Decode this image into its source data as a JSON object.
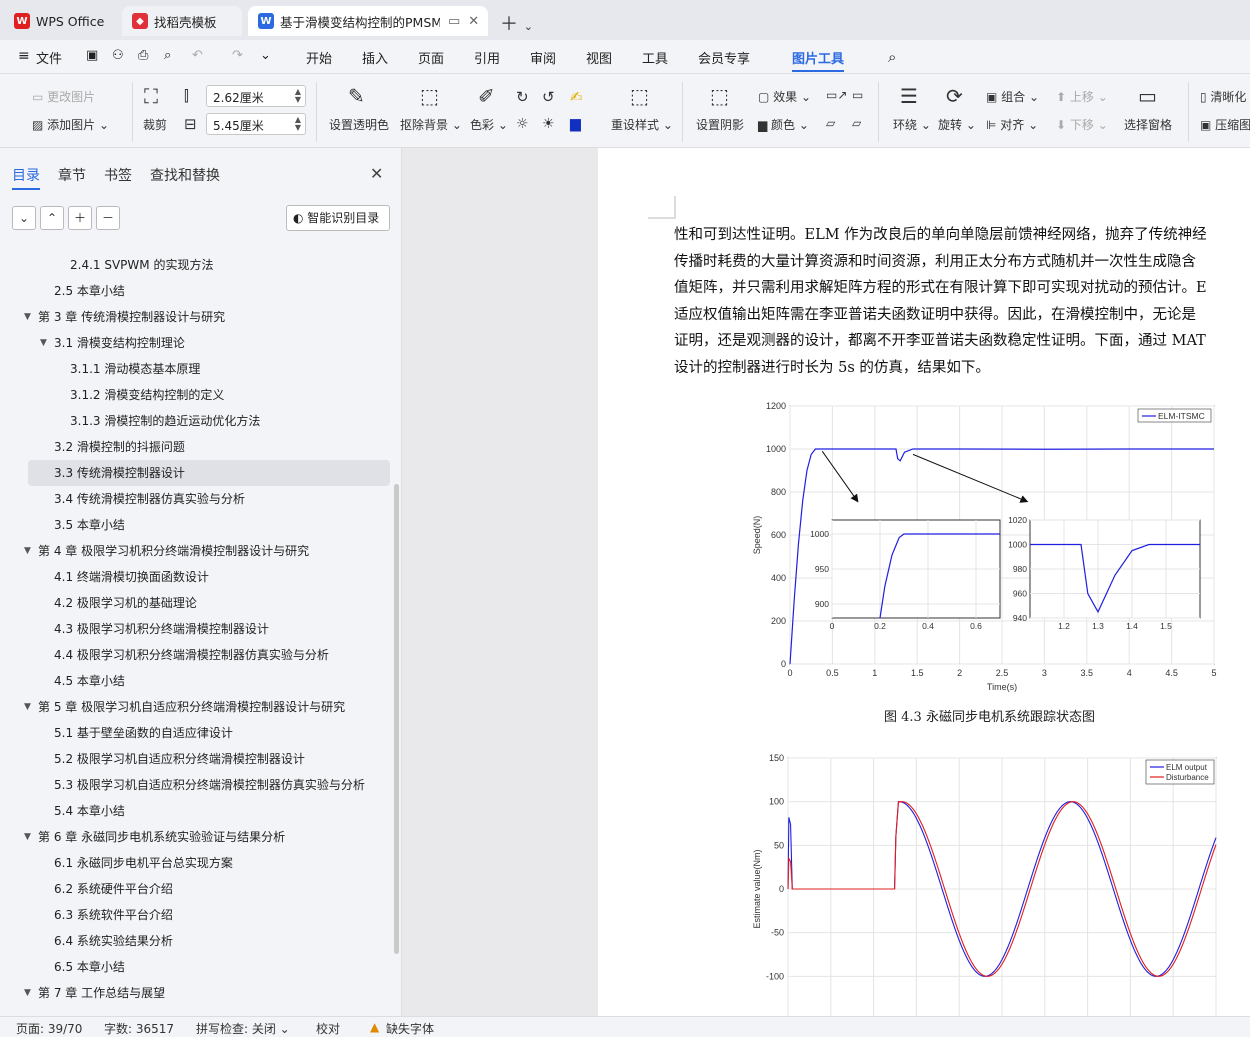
{
  "tabs": [
    {
      "label": "WPS Office",
      "icon": "wps-logo-icon"
    },
    {
      "label": "找稻壳模板",
      "icon": "docer-icon"
    },
    {
      "label": "基于滑模变结构控制的PMSM",
      "icon": "word-doc-icon"
    }
  ],
  "menu": {
    "file": "文件",
    "items": [
      "开始",
      "插入",
      "页面",
      "引用",
      "审阅",
      "视图",
      "工具",
      "会员专享"
    ],
    "active": "图片工具"
  },
  "ribbon": {
    "change_pic": "更改图片",
    "add_pic": "添加图片",
    "crop": "裁剪",
    "width": "2.62厘米",
    "height": "5.45厘米",
    "transparent": "设置透明色",
    "remove_bg": "抠除背景",
    "color": "色彩",
    "reset_style": "重设样式",
    "shadow": "设置阴影",
    "effect": "效果",
    "color2": "颜色",
    "wrap": "环绕",
    "rotate": "旋转",
    "group": "组合",
    "align": "对齐",
    "up": "上移",
    "down": "下移",
    "select_pane": "选择窗格",
    "clear": "清晰化",
    "compress": "压缩图"
  },
  "sidebar": {
    "tabs": [
      "目录",
      "章节",
      "书签",
      "查找和替换"
    ],
    "smart": "智能识别目录",
    "toc": [
      {
        "label": "2.4.1 SVPWM 的实现方法",
        "level": 3
      },
      {
        "label": "2.5  本章小结",
        "level": 2
      },
      {
        "label": "第 3 章  传统滑模控制器设计与研究",
        "level": 1
      },
      {
        "label": "3.1  滑模变结构控制理论",
        "level": 2
      },
      {
        "label": "3.1.1  滑动模态基本原理",
        "level": 3
      },
      {
        "label": "3.1.2  滑模变结构控制的定义",
        "level": 3
      },
      {
        "label": "3.1.3  滑模控制的趋近运动优化方法",
        "level": 3
      },
      {
        "label": "3.2  滑模控制的抖振问题",
        "level": 2
      },
      {
        "label": "3.3  传统滑模控制器设计",
        "level": 2
      },
      {
        "label": "3.4  传统滑模控制器仿真实验与分析",
        "level": 2
      },
      {
        "label": "3.5  本章小结",
        "level": 2
      },
      {
        "label": "第 4 章  极限学习机积分终端滑模控制器设计与研究",
        "level": 1
      },
      {
        "label": "4.1  终端滑模切换面函数设计",
        "level": 2
      },
      {
        "label": "4.2  极限学习机的基础理论",
        "level": 2
      },
      {
        "label": "4.3  极限学习机积分终端滑模控制器设计",
        "level": 2
      },
      {
        "label": "4.4  极限学习机积分终端滑模控制器仿真实验与分析",
        "level": 2
      },
      {
        "label": "4.5  本章小结",
        "level": 2
      },
      {
        "label": "第 5 章  极限学习机自适应积分终端滑模控制器设计与研究",
        "level": 1
      },
      {
        "label": "5.1  基于壁垒函数的自适应律设计",
        "level": 2
      },
      {
        "label": "5.2  极限学习机自适应积分终端滑模控制器设计",
        "level": 2
      },
      {
        "label": "5.3  极限学习机自适应积分终端滑模控制器仿真实验与分析",
        "level": 2
      },
      {
        "label": "5.4  本章小结",
        "level": 2
      },
      {
        "label": "第 6 章  永磁同步电机系统实验验证与结果分析",
        "level": 1
      },
      {
        "label": "6.1  永磁同步电机平台总实现方案",
        "level": 2
      },
      {
        "label": "6.2  系统硬件平台介绍",
        "level": 2
      },
      {
        "label": "6.3  系统软件平台介绍",
        "level": 2
      },
      {
        "label": "6.4  系统实验结果分析",
        "level": 2
      },
      {
        "label": "6.5  本章小结",
        "level": 2
      },
      {
        "label": "第 7 章  工作总结与展望",
        "level": 1
      }
    ]
  },
  "document": {
    "lines": [
      "性和可到达性证明。ELM 作为改良后的单向单隐层前馈神经网络，抛弃了传统神经",
      "传播时耗费的大量计算资源和时间资源，利用正太分布方式随机并一次性生成隐含",
      "值矩阵，并只需利用求解矩阵方程的形式在有限计算下即可实现对扰动的预估计。E",
      "适应权值输出矩阵需在李亚普诺夫函数证明中获得。因此，在滑模控制中，无论是",
      "证明，还是观测器的设计，都离不开李亚普诺夫函数稳定性证明。下面，通过 MAT",
      "设计的控制器进行时长为 5s 的仿真，结果如下。"
    ],
    "caption": "图 4.3  永磁同步电机系统跟踪状态图"
  },
  "chart_data": [
    {
      "type": "line",
      "xlabel": "Time(s)",
      "ylabel": "Speed(N)",
      "xlim": [
        0,
        5
      ],
      "ylim": [
        0,
        1200
      ],
      "x_ticks": [
        "0",
        "0.5",
        "1",
        "1.5",
        "2",
        "2.5",
        "3",
        "3.5",
        "4",
        "4.5",
        "5"
      ],
      "y_ticks": [
        "0",
        "200",
        "400",
        "600",
        "800",
        "1000",
        "1200"
      ],
      "legend": "top-right",
      "grid": true,
      "series": [
        {
          "name": "ELM-ITSMC",
          "color": "#1f1fe0",
          "x": [
            0,
            0.05,
            0.1,
            0.15,
            0.2,
            0.25,
            0.3,
            0.35,
            0.4,
            1.25,
            1.27,
            1.3,
            1.35,
            1.45,
            2,
            3,
            4,
            5
          ],
          "y": [
            0,
            300,
            560,
            760,
            900,
            975,
            1000,
            1000,
            1000,
            1000,
            955,
            945,
            985,
            1000,
            1000,
            999,
            1000,
            1000
          ]
        }
      ],
      "insets": [
        {
          "xlim": [
            0,
            0.7
          ],
          "ylim": [
            880,
            1020
          ],
          "x_ticks": [
            "0",
            "0.2",
            "0.4",
            "0.6"
          ],
          "y_ticks": [
            "900",
            "950",
            "1000"
          ],
          "x": [
            0.2,
            0.22,
            0.25,
            0.28,
            0.3,
            0.7
          ],
          "y": [
            880,
            925,
            970,
            995,
            1000,
            1000
          ]
        },
        {
          "xlim": [
            1.1,
            1.6
          ],
          "ylim": [
            940,
            1020
          ],
          "x_ticks": [
            "1.2",
            "1.3",
            "1.4",
            "1.5"
          ],
          "y_ticks": [
            "940",
            "960",
            "980",
            "1000",
            "1020"
          ],
          "x": [
            1.1,
            1.25,
            1.27,
            1.3,
            1.35,
            1.4,
            1.45,
            1.6
          ],
          "y": [
            1000,
            1000,
            960,
            945,
            975,
            995,
            1000,
            1000
          ]
        }
      ]
    },
    {
      "type": "line",
      "xlabel": "",
      "ylabel": "Estimate value(Nm)",
      "xlim": [
        0,
        5
      ],
      "ylim": [
        -150,
        150
      ],
      "y_ticks": [
        "150",
        "100",
        "50",
        "0",
        "-50",
        "-100",
        "-150"
      ],
      "legend": "top-right",
      "grid": true,
      "series": [
        {
          "name": "ELM output",
          "color": "#1f1fe0"
        },
        {
          "name": "Disturbance",
          "color": "#e01f1f"
        }
      ]
    }
  ],
  "status": {
    "page": "页面: 39/70",
    "words": "字数: 36517",
    "spell": "拼写检查: 关闭",
    "proof": "校对",
    "font_missing": "缺失字体"
  }
}
